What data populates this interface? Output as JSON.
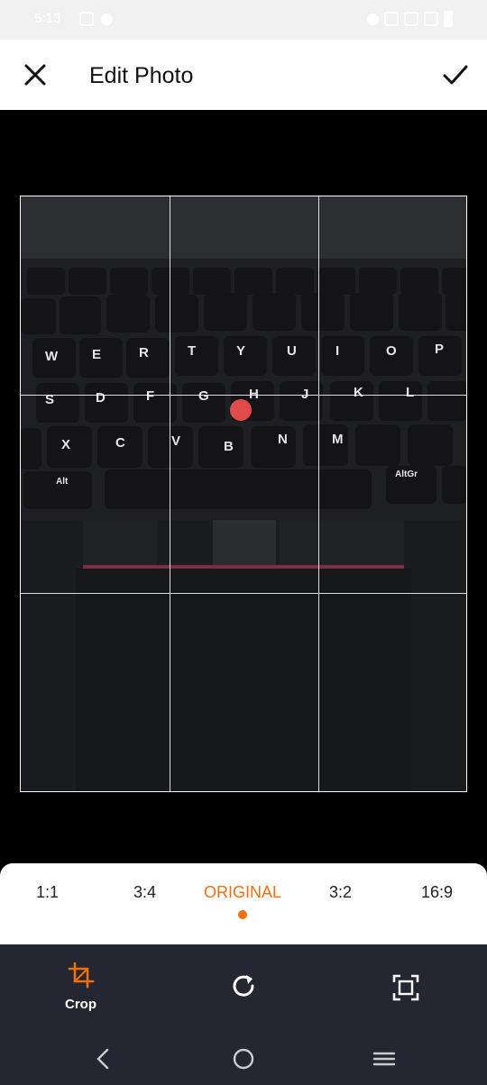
{
  "status_bar": {
    "time": "5:13"
  },
  "app_bar": {
    "title": "Edit Photo",
    "close_icon": "close-icon",
    "confirm_icon": "check-icon"
  },
  "aspect_ratios": {
    "items": [
      "1:1",
      "3:4",
      "ORIGINAL",
      "3:2",
      "16:9"
    ],
    "selected": "ORIGINAL"
  },
  "tools": {
    "crop_label": "Crop",
    "rotate_icon": "rotate-icon",
    "fit_icon": "fit-frame-icon"
  },
  "photo": {
    "key_labels": [
      "W",
      "E",
      "R",
      "T",
      "Y",
      "U",
      "I",
      "O",
      "P",
      "S",
      "D",
      "F",
      "G",
      "H",
      "J",
      "K",
      "L",
      "X",
      "C",
      "V",
      "B",
      "N",
      "M",
      "Alt",
      "AltGr"
    ]
  },
  "colors": {
    "accent": "#f07010",
    "toolbar_bg": "#242631"
  }
}
